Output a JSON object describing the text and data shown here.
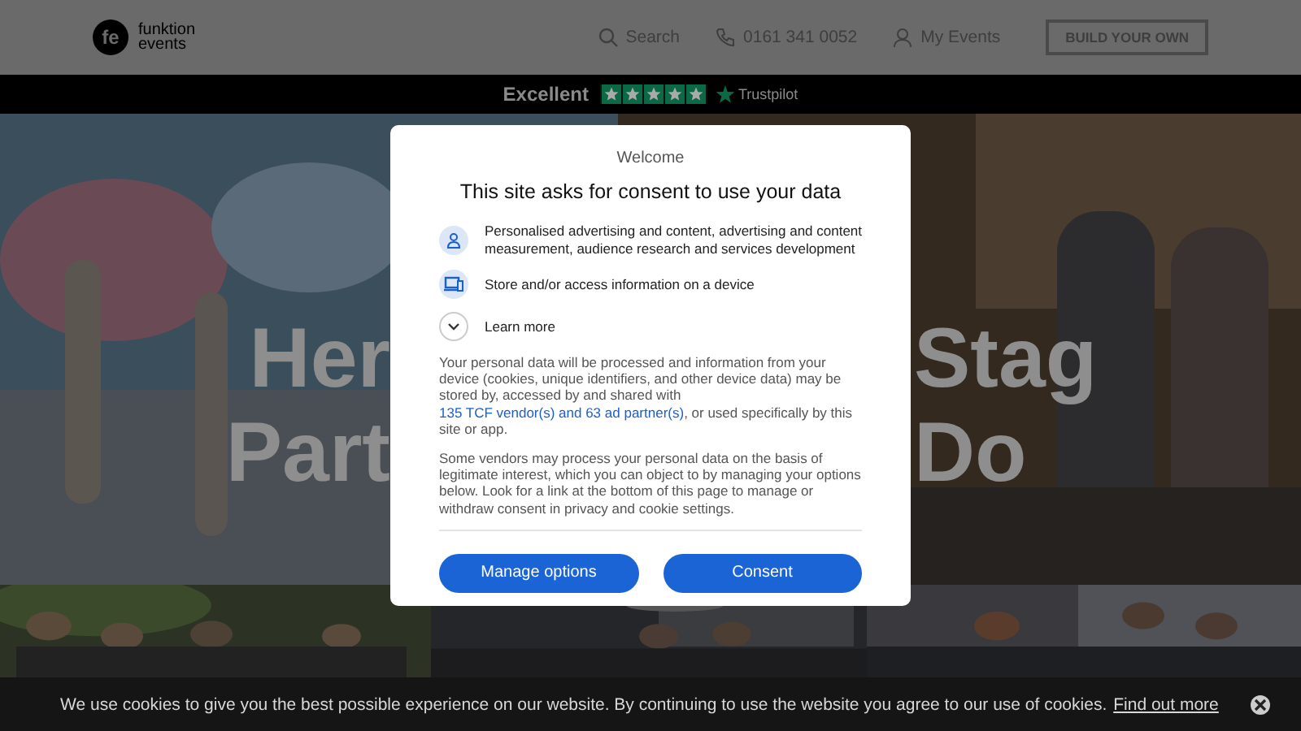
{
  "header": {
    "logo_mark": "fe",
    "logo_lines": [
      "funktion",
      "events"
    ],
    "nav": [
      {
        "label": "Search",
        "kind": "search"
      },
      {
        "label": "0161 341 0052",
        "kind": "phone"
      },
      {
        "label": "My Events",
        "kind": "account"
      }
    ],
    "cta": "BUILD YOUR OWN"
  },
  "rating_bar": {
    "label": "Excellent",
    "stars": 5,
    "brand": "Trustpilot"
  },
  "hero": {
    "title_left": [
      "Her",
      "Part"
    ],
    "title_right": [
      "Stag",
      "Do"
    ]
  },
  "consent_dialog": {
    "kicker": "Welcome",
    "title": "This site asks for consent to use your data",
    "purposes": [
      {
        "kind": "advertising",
        "text": "Personalised advertising and content, advertising and content measurement, audience research and services development"
      },
      {
        "kind": "storage",
        "text": "Store and/or access information on a device"
      }
    ],
    "learn_more": {
      "label": "Learn more",
      "expanded": false
    },
    "paragraph_1": {
      "before": "Your personal data will be processed and information from your device (cookies, unique identifiers, and other device data) may be stored by, accessed by and shared with ",
      "link": "135 TCF vendor(s) and 63 ad partner(s)",
      "after": ", or used specifically by this site or app."
    },
    "paragraph_2": "Some vendors may process your personal data on the basis of legitimate interest, which you can object to by managing your options below. Look for a link at the bottom of this page to manage or withdraw consent in privacy and cookie settings.",
    "buttons": [
      "Manage options",
      "Consent"
    ]
  },
  "cookie_bar": {
    "text": "We use cookies to give you the best possible experience on our website. By continuing to use the website you agree to our use of cookies.",
    "link": "Find out more"
  }
}
